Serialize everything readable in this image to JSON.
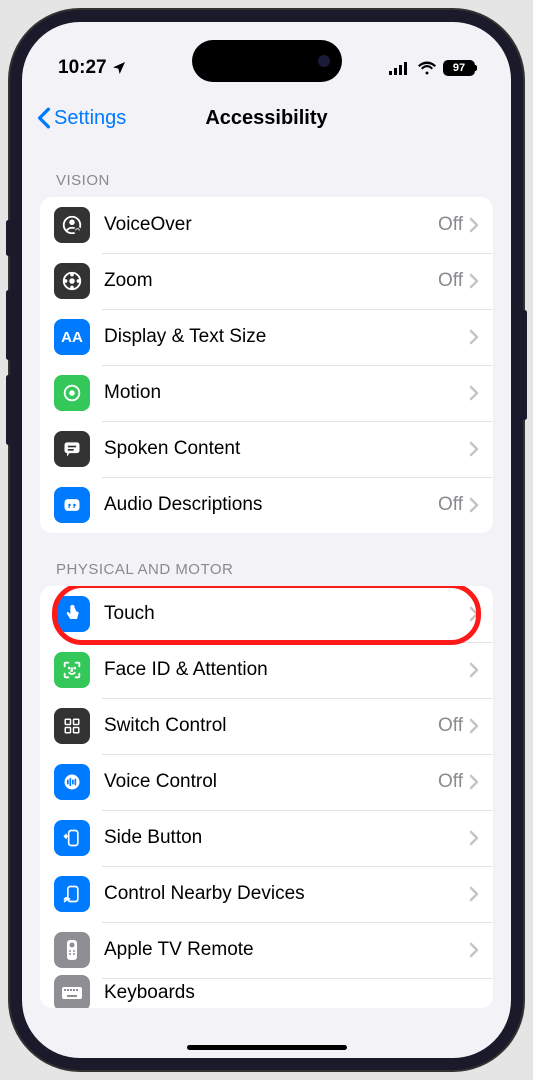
{
  "statusBar": {
    "time": "10:27",
    "batteryPct": "97"
  },
  "nav": {
    "back": "Settings",
    "title": "Accessibility"
  },
  "sections": {
    "vision": {
      "header": "VISION",
      "rows": {
        "voiceover": {
          "label": "VoiceOver",
          "value": "Off"
        },
        "zoom": {
          "label": "Zoom",
          "value": "Off"
        },
        "display": {
          "label": "Display & Text Size",
          "value": ""
        },
        "motion": {
          "label": "Motion",
          "value": ""
        },
        "spoken": {
          "label": "Spoken Content",
          "value": ""
        },
        "audiodesc": {
          "label": "Audio Descriptions",
          "value": "Off"
        }
      }
    },
    "motor": {
      "header": "PHYSICAL AND MOTOR",
      "rows": {
        "touch": {
          "label": "Touch",
          "value": ""
        },
        "faceid": {
          "label": "Face ID & Attention",
          "value": ""
        },
        "switch": {
          "label": "Switch Control",
          "value": "Off"
        },
        "voice": {
          "label": "Voice Control",
          "value": "Off"
        },
        "sidebutton": {
          "label": "Side Button",
          "value": ""
        },
        "nearby": {
          "label": "Control Nearby Devices",
          "value": ""
        },
        "appletv": {
          "label": "Apple TV Remote",
          "value": ""
        },
        "keyboards": {
          "label": "Keyboards",
          "value": ""
        }
      }
    }
  }
}
